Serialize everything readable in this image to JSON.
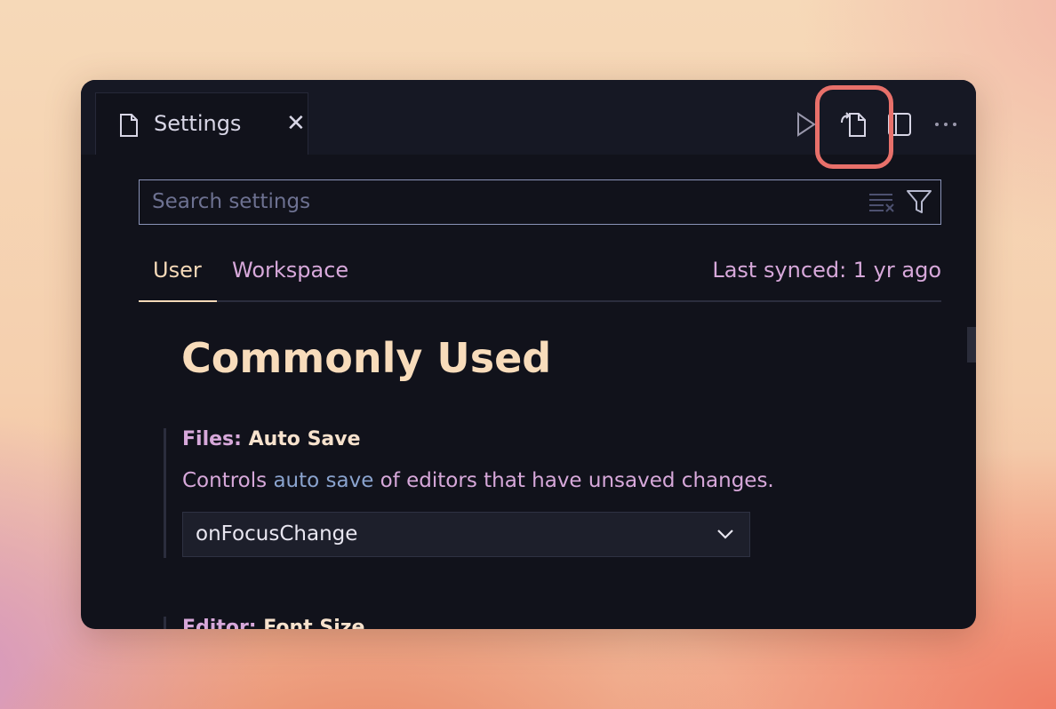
{
  "tab": {
    "label": "Settings",
    "close": "✕"
  },
  "search": {
    "placeholder": "Search settings"
  },
  "scope_tabs": {
    "user": "User",
    "workspace": "Workspace"
  },
  "sync_status": "Last synced: 1 yr ago",
  "section_title": "Commonly Used",
  "settings": [
    {
      "category": "Files: ",
      "name": "Auto Save",
      "desc_before": "Controls ",
      "desc_link": "auto save",
      "desc_after": " of editors that have unsaved changes.",
      "value": "onFocusChange"
    },
    {
      "category": "Editor: ",
      "name": "Font Size"
    }
  ],
  "colors": {
    "accent_highlight": "#e8706a",
    "heading": "#f8dcbb",
    "muted_purple": "#d7a8da",
    "link": "#8aa3ce"
  },
  "icons": [
    "file-icon",
    "close-icon",
    "run-icon",
    "open-settings-json-icon",
    "split-editor-icon",
    "more-actions-icon",
    "clear-filter-icon",
    "filter-icon",
    "chevron-down-icon"
  ]
}
